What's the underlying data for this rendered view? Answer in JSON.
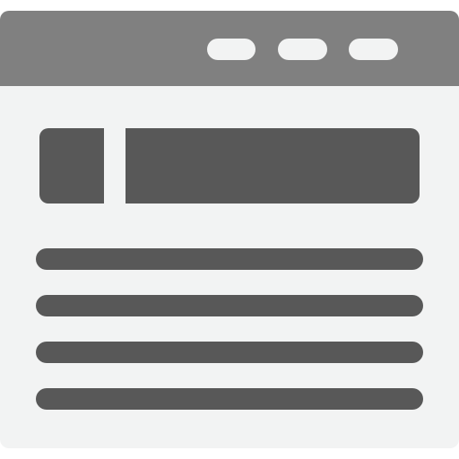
{
  "icon": "web-page-layout-icon",
  "colors": {
    "titlebar": "#808080",
    "page_background": "#f2f3f3",
    "content_blocks": "#585858",
    "window_controls": "#f2f3f3"
  },
  "titlebar": {
    "controls": [
      "window-control",
      "window-control",
      "window-control"
    ]
  },
  "content": {
    "banner": [
      "banner-segment-left",
      "banner-segment-right"
    ],
    "text_lines": 4
  }
}
